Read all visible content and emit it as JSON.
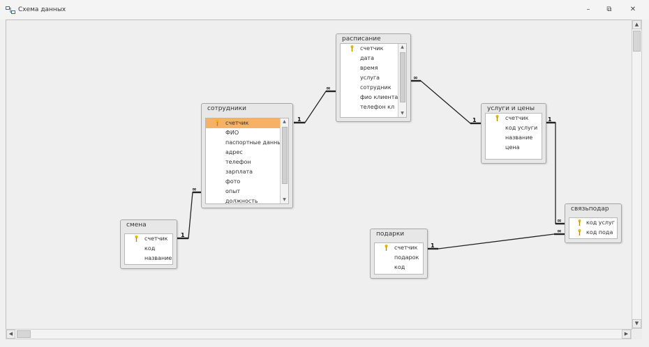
{
  "window": {
    "title": "Схема данных",
    "controls": {
      "minimize": "–",
      "restore": "⧉",
      "close": "✕"
    }
  },
  "colors": {
    "selected_field": "#f5b166",
    "key": "#e6b800",
    "line": "#222222"
  },
  "tables": {
    "raspisanie": {
      "title": "расписание",
      "fields": [
        "счетчик",
        "дата",
        "время",
        "услуга",
        "сотрудник",
        "фио клиента",
        "телефон кл"
      ]
    },
    "sotrudniki": {
      "title": "сотрудники",
      "fields": [
        "счетчик",
        "ФИО",
        "паспортные данные",
        "адрес",
        "телефон",
        "зарплата",
        "фото",
        "опыт",
        "должность"
      ]
    },
    "uslugi": {
      "title": "услуги и цены",
      "fields": [
        "счетчик",
        "код услуги",
        "название",
        "цена"
      ]
    },
    "smena": {
      "title": "смена",
      "fields": [
        "счетчик",
        "код",
        "название"
      ]
    },
    "podarki": {
      "title": "подарки",
      "fields": [
        "счетчик",
        "подарок",
        "код"
      ]
    },
    "svyaz": {
      "title": "связьподар",
      "fields": [
        "код услуг",
        "код пода"
      ]
    }
  },
  "relationships": {
    "one": "1",
    "many": "∞"
  }
}
